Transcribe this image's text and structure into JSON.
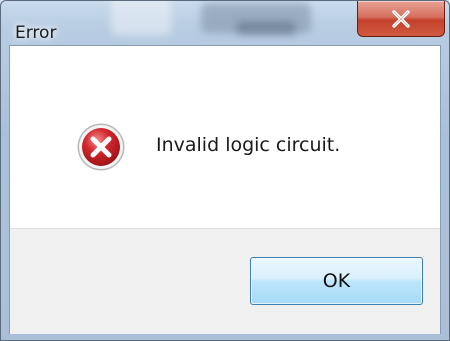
{
  "window": {
    "title": "Error"
  },
  "titlebar": {
    "close_glyph": "X",
    "close_icon": "close-icon"
  },
  "dialog": {
    "icon": "error-icon",
    "message": "Invalid logic circuit."
  },
  "buttons": {
    "ok_label": "OK"
  },
  "colors": {
    "close_button": "#c4412c",
    "error_icon": "#c8242a",
    "ok_button_border": "#3c7fb1",
    "button_area": "#f0f0f0"
  }
}
